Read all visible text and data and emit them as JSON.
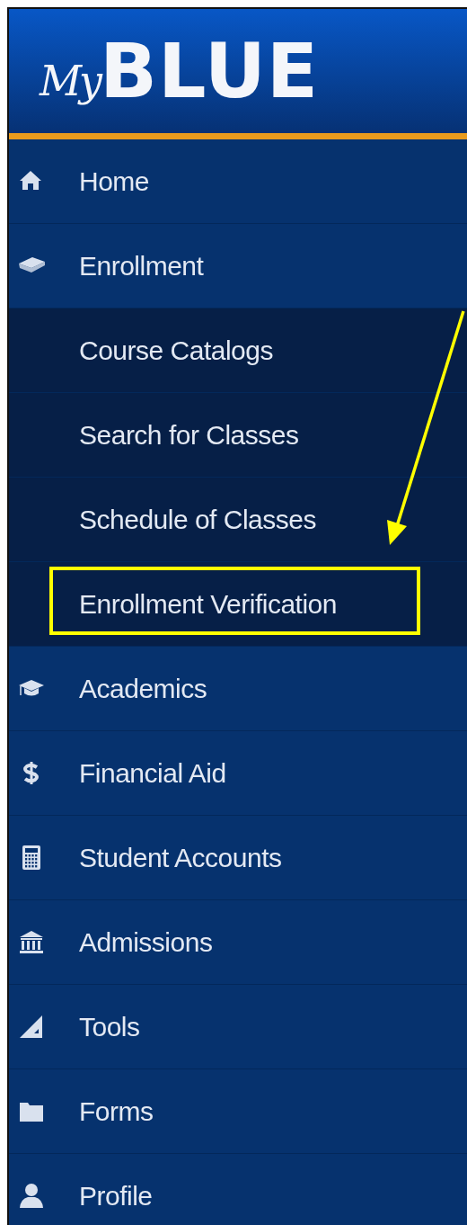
{
  "logo": {
    "script": "My",
    "word": "BLUE"
  },
  "menu": [
    {
      "label": "Home"
    },
    {
      "label": "Enrollment",
      "children": [
        {
          "label": "Course Catalogs",
          "highlighted": false
        },
        {
          "label": "Search for Classes",
          "highlighted": false
        },
        {
          "label": "Schedule of Classes",
          "highlighted": false
        },
        {
          "label": "Enrollment Verification",
          "highlighted": true
        }
      ]
    },
    {
      "label": "Academics"
    },
    {
      "label": "Financial Aid"
    },
    {
      "label": "Student Accounts"
    },
    {
      "label": "Admissions"
    },
    {
      "label": "Tools"
    },
    {
      "label": "Forms"
    },
    {
      "label": "Profile"
    }
  ],
  "annotation": {
    "arrow": true
  }
}
